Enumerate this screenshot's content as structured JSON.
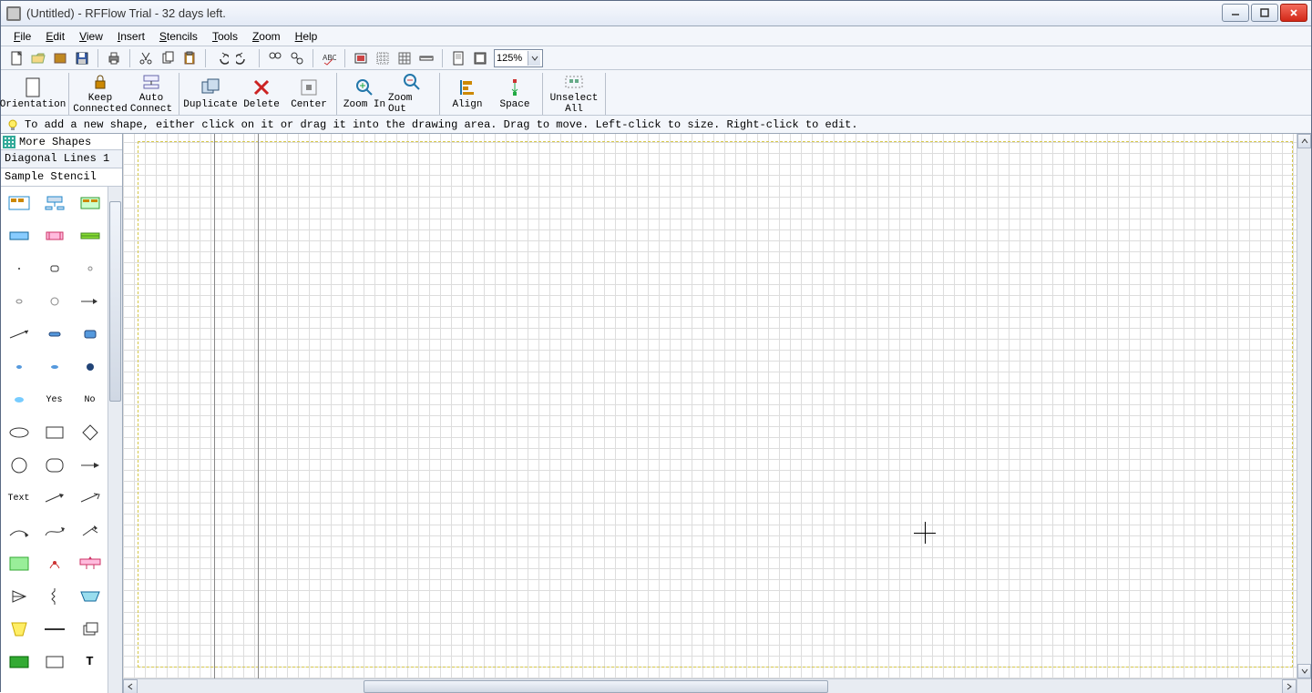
{
  "window": {
    "title": "(Untitled) - RFFlow Trial - 32 days left."
  },
  "menubar": {
    "file": "File",
    "edit": "Edit",
    "view": "View",
    "insert": "Insert",
    "stencils": "Stencils",
    "tools": "Tools",
    "zoom": "Zoom",
    "help": "Help"
  },
  "toolbar1": {
    "zoom_value": "125%"
  },
  "toolbar2": {
    "orientation": "Orientation",
    "keep_connected_l1": "Keep",
    "keep_connected_l2": "Connected",
    "auto_connect_l1": "Auto",
    "auto_connect_l2": "Connect",
    "duplicate": "Duplicate",
    "delete": "Delete",
    "center": "Center",
    "zoom_in": "Zoom In",
    "zoom_out": "Zoom Out",
    "align": "Align",
    "space": "Space",
    "unselect_l1": "Unselect",
    "unselect_l2": "All"
  },
  "hint": "To add a new shape, either click on it or drag it into the drawing area. Drag to move. Left-click to size. Right-click to edit.",
  "stencil": {
    "more_shapes": "More Shapes",
    "tab1": "Diagonal Lines 1",
    "tab2": "Sample Stencil",
    "label_yes": "Yes",
    "label_no": "No",
    "label_text": "Text",
    "label_t": "T"
  }
}
